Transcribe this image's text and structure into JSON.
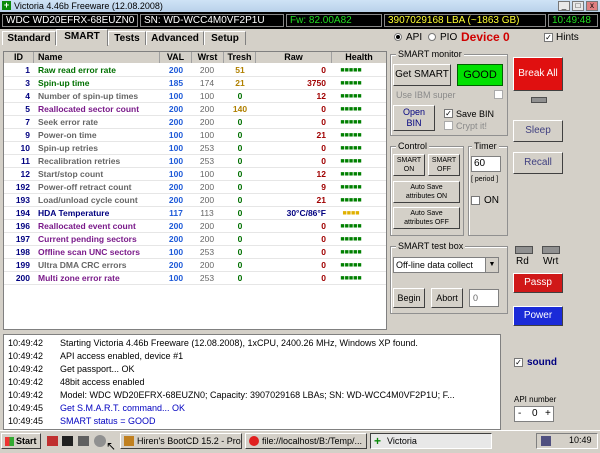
{
  "window": {
    "title": "Victoria 4.46b Freeware (12.08.2008)"
  },
  "infobar": {
    "model": "WDC WD20EFRX-68EUZN0",
    "serial": "SN: WD-WCC4M0VF2P1U",
    "firmware": "Fw: 82.00A82",
    "lba": "3907029168 LBA (~1863 GB)",
    "clock": "10:49:48"
  },
  "tabs": [
    "Standard",
    "SMART",
    "Tests",
    "Advanced",
    "Setup"
  ],
  "mode": {
    "api": "API",
    "pio": "PIO",
    "device": "Device 0",
    "hints": "Hints"
  },
  "table": {
    "headers": [
      "ID",
      "Name",
      "VAL",
      "Wrst",
      "Tresh",
      "Raw",
      "Health"
    ],
    "rows": [
      {
        "id": "1",
        "name": "Raw read error rate",
        "val": "200",
        "wrst": "200",
        "tresh": "51",
        "raw": "0",
        "health": "■■■■■",
        "name_color": "#007000",
        "tresh_color": "#b08000",
        "raw_color": "#a00000",
        "health_color": "#008000"
      },
      {
        "id": "3",
        "name": "Spin-up time",
        "val": "185",
        "wrst": "174",
        "tresh": "21",
        "raw": "3750",
        "health": "■■■■■",
        "name_color": "#007000",
        "tresh_color": "#b08000",
        "raw_color": "#a00000",
        "health_color": "#008000"
      },
      {
        "id": "4",
        "name": "Number of spin-up times",
        "val": "100",
        "wrst": "100",
        "tresh": "0",
        "raw": "12",
        "health": "■■■■■",
        "name_color": "#666666",
        "tresh_color": "#007000",
        "raw_color": "#a00000",
        "health_color": "#008000"
      },
      {
        "id": "5",
        "name": "Reallocated sector count",
        "val": "200",
        "wrst": "200",
        "tresh": "140",
        "raw": "0",
        "health": "■■■■■",
        "name_color": "#7a1a8a",
        "tresh_color": "#b08000",
        "raw_color": "#a00000",
        "health_color": "#008000"
      },
      {
        "id": "7",
        "name": "Seek error rate",
        "val": "200",
        "wrst": "200",
        "tresh": "0",
        "raw": "0",
        "health": "■■■■■",
        "name_color": "#666666",
        "tresh_color": "#007000",
        "raw_color": "#a00000",
        "health_color": "#008000"
      },
      {
        "id": "9",
        "name": "Power-on time",
        "val": "100",
        "wrst": "100",
        "tresh": "0",
        "raw": "21",
        "health": "■■■■■",
        "name_color": "#666666",
        "tresh_color": "#007000",
        "raw_color": "#a00000",
        "health_color": "#008000"
      },
      {
        "id": "10",
        "name": "Spin-up retries",
        "val": "100",
        "wrst": "253",
        "tresh": "0",
        "raw": "0",
        "health": "■■■■■",
        "name_color": "#666666",
        "tresh_color": "#007000",
        "raw_color": "#a00000",
        "health_color": "#008000"
      },
      {
        "id": "11",
        "name": "Recalibration retries",
        "val": "100",
        "wrst": "253",
        "tresh": "0",
        "raw": "0",
        "health": "■■■■■",
        "name_color": "#666666",
        "tresh_color": "#007000",
        "raw_color": "#a00000",
        "health_color": "#008000"
      },
      {
        "id": "12",
        "name": "Start/stop count",
        "val": "100",
        "wrst": "100",
        "tresh": "0",
        "raw": "12",
        "health": "■■■■■",
        "name_color": "#666666",
        "tresh_color": "#007000",
        "raw_color": "#a00000",
        "health_color": "#008000"
      },
      {
        "id": "192",
        "name": "Power-off retract count",
        "val": "200",
        "wrst": "200",
        "tresh": "0",
        "raw": "9",
        "health": "■■■■■",
        "name_color": "#666666",
        "tresh_color": "#007000",
        "raw_color": "#a00000",
        "health_color": "#008000"
      },
      {
        "id": "193",
        "name": "Load/unload cycle count",
        "val": "200",
        "wrst": "200",
        "tresh": "0",
        "raw": "21",
        "health": "■■■■■",
        "name_color": "#666666",
        "tresh_color": "#007000",
        "raw_color": "#a00000",
        "health_color": "#008000"
      },
      {
        "id": "194",
        "name": "HDA Temperature",
        "val": "117",
        "wrst": "113",
        "tresh": "0",
        "raw": "30°C/86°F",
        "health": "■■■■",
        "name_color": "#000080",
        "tresh_color": "#007000",
        "raw_color": "#000080",
        "health_color": "#e0b000"
      },
      {
        "id": "196",
        "name": "Reallocated event count",
        "val": "200",
        "wrst": "200",
        "tresh": "0",
        "raw": "0",
        "health": "■■■■■",
        "name_color": "#7a1a8a",
        "tresh_color": "#007000",
        "raw_color": "#a00000",
        "health_color": "#008000"
      },
      {
        "id": "197",
        "name": "Current pending sectors",
        "val": "200",
        "wrst": "200",
        "tresh": "0",
        "raw": "0",
        "health": "■■■■■",
        "name_color": "#7a1a8a",
        "tresh_color": "#007000",
        "raw_color": "#a00000",
        "health_color": "#008000"
      },
      {
        "id": "198",
        "name": "Offline scan UNC sectors",
        "val": "100",
        "wrst": "253",
        "tresh": "0",
        "raw": "0",
        "health": "■■■■■",
        "name_color": "#7a1a8a",
        "tresh_color": "#007000",
        "raw_color": "#a00000",
        "health_color": "#008000"
      },
      {
        "id": "199",
        "name": "Ultra DMA CRC errors",
        "val": "200",
        "wrst": "200",
        "tresh": "0",
        "raw": "0",
        "health": "■■■■■",
        "name_color": "#666666",
        "tresh_color": "#007000",
        "raw_color": "#a00000",
        "health_color": "#008000"
      },
      {
        "id": "200",
        "name": "Multi zone error rate",
        "val": "100",
        "wrst": "253",
        "tresh": "0",
        "raw": "0",
        "health": "■■■■■",
        "name_color": "#7a1a8a",
        "tresh_color": "#007000",
        "raw_color": "#a00000",
        "health_color": "#008000"
      }
    ]
  },
  "smart_monitor": {
    "title": "SMART monitor",
    "get_smart": "Get SMART",
    "status": "GOOD",
    "use_ibm": "Use IBM super",
    "open_bin_1": "Open",
    "open_bin_2": "BIN",
    "save_bin": "Save BIN",
    "crypt": "Crypt it!"
  },
  "control": {
    "title": "Control",
    "smart_on_1": "SMART",
    "smart_on_2": "ON",
    "smart_off_1": "SMART",
    "smart_off_2": "OFF",
    "autosave_on_1": "Auto Save",
    "autosave_on_2": "attributes ON",
    "autosave_off_1": "Auto Save",
    "autosave_off_2": "attributes OFF"
  },
  "timer": {
    "title": "Timer",
    "value": "60",
    "period": "[ period ]",
    "on": "ON"
  },
  "test_box": {
    "title": "SMART test box",
    "selected": "Off-line data collect",
    "begin": "Begin",
    "abort": "Abort",
    "value": "0"
  },
  "side": {
    "break_all": "Break All",
    "sleep": "Sleep",
    "recall": "Recall",
    "rd": "Rd",
    "wrt": "Wrt",
    "passp": "Passp",
    "power": "Power",
    "sound": "sound",
    "api_number": "API number",
    "api_value": "0"
  },
  "log": [
    {
      "time": "10:49:42",
      "msg": "Starting Victoria 4.46b Freeware (12.08.2008), 1xCPU, 2400.26 MHz, Windows XP found.",
      "color": "#000000"
    },
    {
      "time": "10:49:42",
      "msg": "API access enabled, device #1",
      "color": "#000000"
    },
    {
      "time": "10:49:42",
      "msg": "Get passport... OK",
      "color": "#000000"
    },
    {
      "time": "10:49:42",
      "msg": "48bit access enabled",
      "color": "#000000"
    },
    {
      "time": "10:49:42",
      "msg": "Model: WDC WD20EFRX-68EUZN0; Capacity: 3907029168 LBAs; SN: WD-WCC4M0VF2P1U; F...",
      "color": "#000000"
    },
    {
      "time": "10:49:45",
      "msg": "Get S.M.A.R.T. command... OK",
      "color": "#0000c0"
    },
    {
      "time": "10:49:45",
      "msg": "SMART status = GOOD",
      "color": "#0000c0"
    }
  ],
  "taskbar": {
    "start": "Start",
    "items": [
      "Hiren's BootCD 15.2 - Pro...",
      "file://localhost/B:/Temp/...",
      "Victoria"
    ],
    "clock": "10:49"
  }
}
